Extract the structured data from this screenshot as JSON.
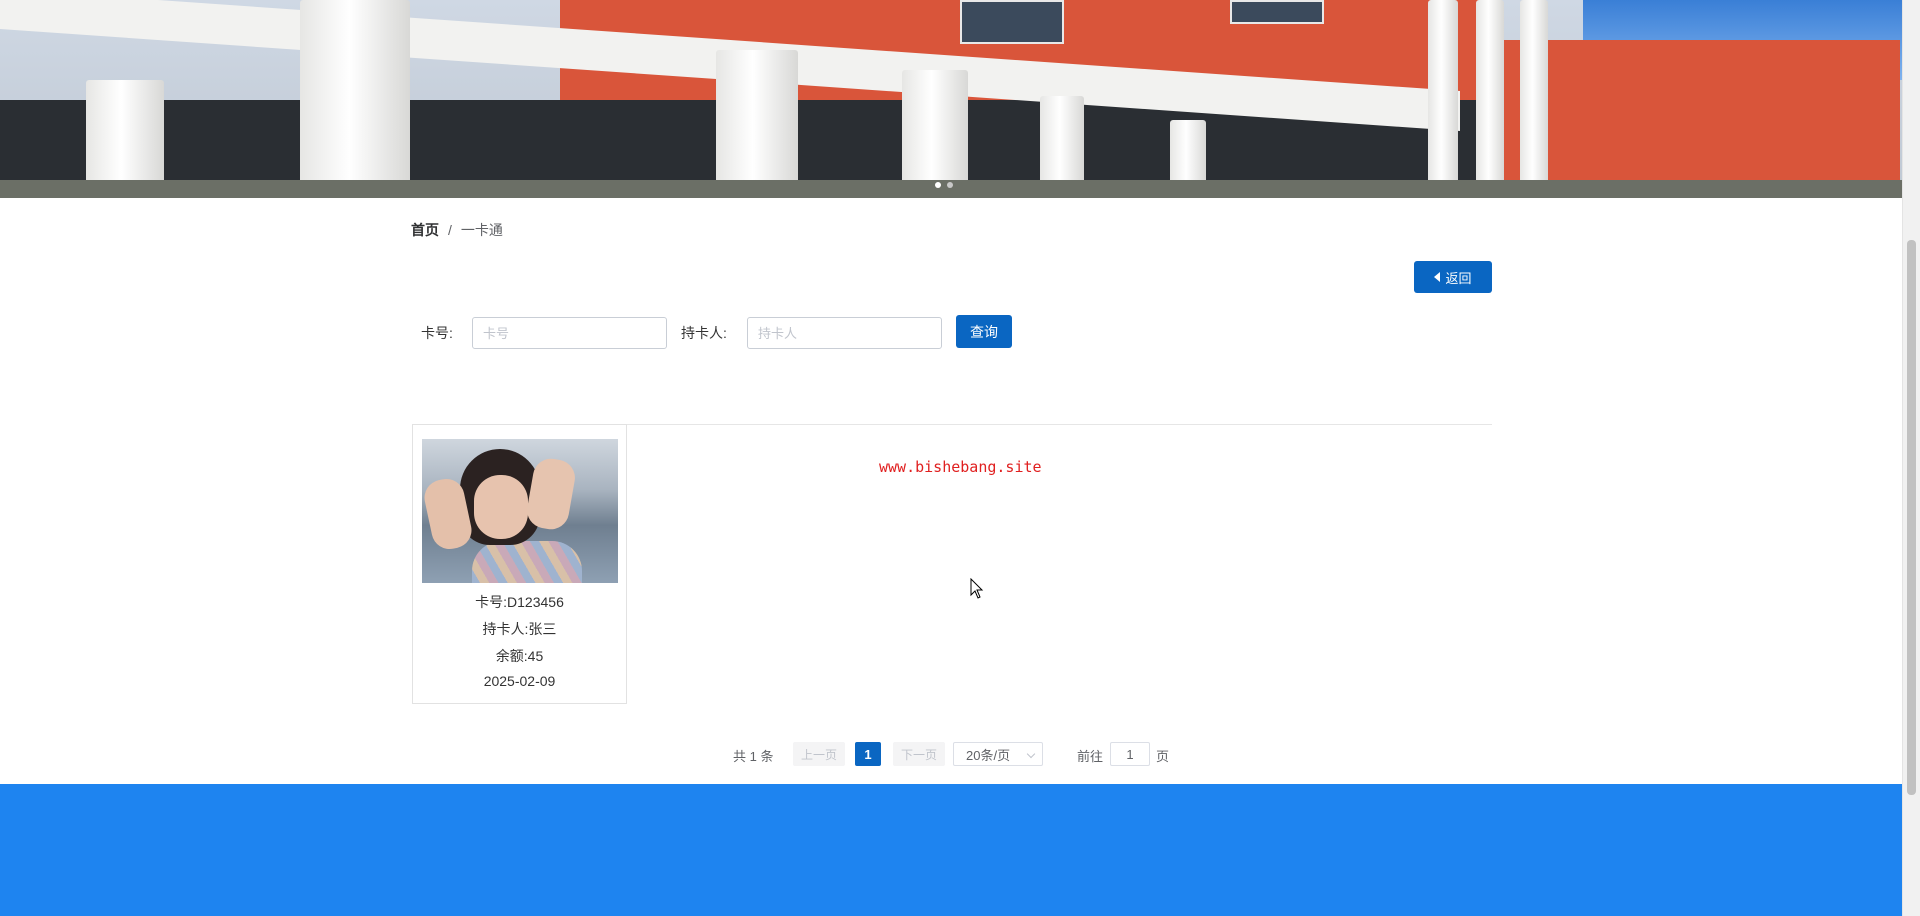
{
  "breadcrumb": {
    "home": "首页",
    "separator": "/",
    "current": "一卡通"
  },
  "back_button": {
    "label": "返回"
  },
  "search": {
    "card_no_label": "卡号:",
    "card_no_placeholder": "卡号",
    "card_no_value": "",
    "holder_label": "持卡人:",
    "holder_placeholder": "持卡人",
    "holder_value": "",
    "query_label": "查询"
  },
  "cards": [
    {
      "card_no": "卡号:D123456",
      "holder": "持卡人:张三",
      "balance": "余额:45",
      "date": "2025-02-09"
    }
  ],
  "watermark": "www.bishebang.site",
  "pagination": {
    "total": "共 1 条",
    "prev": "上一页",
    "current_page": "1",
    "next": "下一页",
    "page_size": "20条/页",
    "goto_label": "前往",
    "goto_value": "1",
    "goto_unit": "页"
  },
  "colors": {
    "primary": "#0a66c2",
    "footer": "#1e84f0",
    "watermark": "#e02020"
  }
}
